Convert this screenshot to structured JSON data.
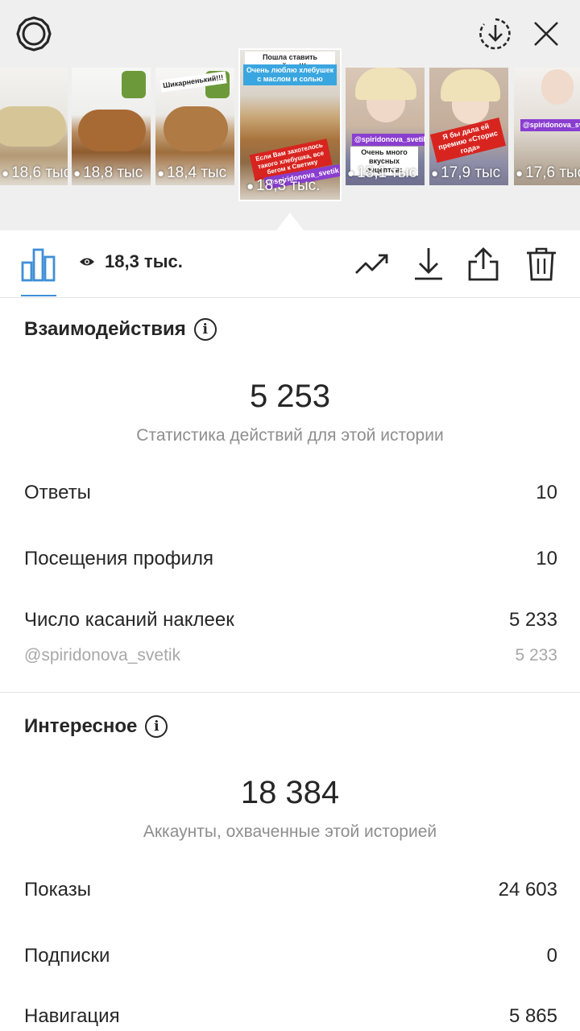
{
  "stories": [
    {
      "views": "18,6 тыс",
      "caption": ""
    },
    {
      "views": "18,8 тыс",
      "caption": ""
    },
    {
      "views": "18,4 тыс",
      "caption": "Шикарненький!!!"
    },
    {
      "views": "18,3 тыс.",
      "caption_top": "Пошла ставить чайник!!!",
      "caption_mid": "Очень люблю хлебушек с маслом и солью",
      "caption_low": "Если Вам захотелось такого хлебушка, все бегом к Светику",
      "handle": "@spiridonova_svetik",
      "selected": true
    },
    {
      "views": "18,1 тыс",
      "handle": "@spiridonova_svetik",
      "caption": "Очень много вкусных рецептов:"
    },
    {
      "views": "17,9 тыс",
      "caption": "Я бы дала ей премию «Сторис года»"
    },
    {
      "views": "17,6 тыс",
      "handle": "@spiridonova_svetik"
    }
  ],
  "stats_bar": {
    "views": "18,3 тыс."
  },
  "interactions": {
    "title": "Взаимодействия",
    "total": "5 253",
    "subtitle": "Статистика действий для этой истории",
    "rows": [
      {
        "label": "Ответы",
        "value": "10"
      },
      {
        "label": "Посещения профиля",
        "value": "10"
      },
      {
        "label": "Число касаний наклеек",
        "value": "5 233"
      }
    ],
    "sticker_row": {
      "label": "@spiridonova_svetik",
      "value": "5 233"
    }
  },
  "discovery": {
    "title": "Интересное",
    "total": "18 384",
    "subtitle": "Аккаунты, охваченные этой историей",
    "rows": [
      {
        "label": "Показы",
        "value": "24 603"
      },
      {
        "label": "Подписки",
        "value": "0"
      },
      {
        "label": "Навигация",
        "value": "5 865"
      }
    ]
  },
  "colors": {
    "accent": "#3f8fd7",
    "muted": "#8e8e8e",
    "text": "#262626"
  }
}
